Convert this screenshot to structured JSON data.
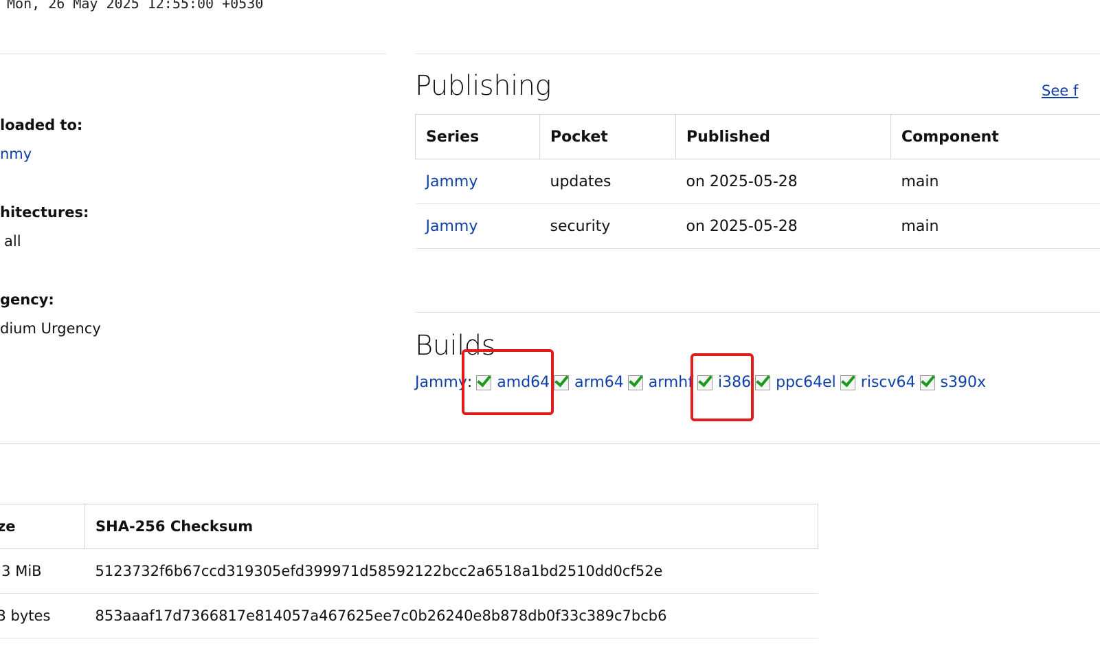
{
  "header": {
    "date": "Mon, 26 May 2025 12:55:00 +0530"
  },
  "sidebar": {
    "uploaded_to_label": "loaded to:",
    "uploaded_to_value": "nmy",
    "architectures_label": "hitectures:",
    "architectures_value": "all",
    "urgency_label": "gency:",
    "urgency_value": "dium Urgency"
  },
  "publishing": {
    "title": "Publishing",
    "see_link": "See f",
    "columns": [
      "Series",
      "Pocket",
      "Published",
      "Component"
    ],
    "rows": [
      {
        "series": "Jammy",
        "pocket": "updates",
        "published": "on 2025-05-28",
        "component": "main"
      },
      {
        "series": "Jammy",
        "pocket": "security",
        "published": "on 2025-05-28",
        "component": "main"
      }
    ]
  },
  "builds": {
    "title": "Builds",
    "series_link": "Jammy",
    "separator": ":",
    "archs": [
      "amd64",
      "arm64",
      "armhf",
      "i386",
      "ppc64el",
      "riscv64",
      "s390x"
    ],
    "highlight_color": "#e21b1b",
    "success_color": "#1a9a1a"
  },
  "files": {
    "columns": [
      "ze",
      "SHA-256 Checksum"
    ],
    "rows": [
      {
        "size": ".3 MiB",
        "checksum": "5123732f6b67ccd319305efd399971d58592122bcc2a6518a1bd2510dd0cf52e"
      },
      {
        "size": "3 bytes",
        "checksum": "853aaaf17d7366817e814057a467625ee7c0b26240e8b878db0f33c389c7bcb6"
      }
    ]
  },
  "colors": {
    "link": "#0e3fa8",
    "divider": "#e2e2e2"
  }
}
